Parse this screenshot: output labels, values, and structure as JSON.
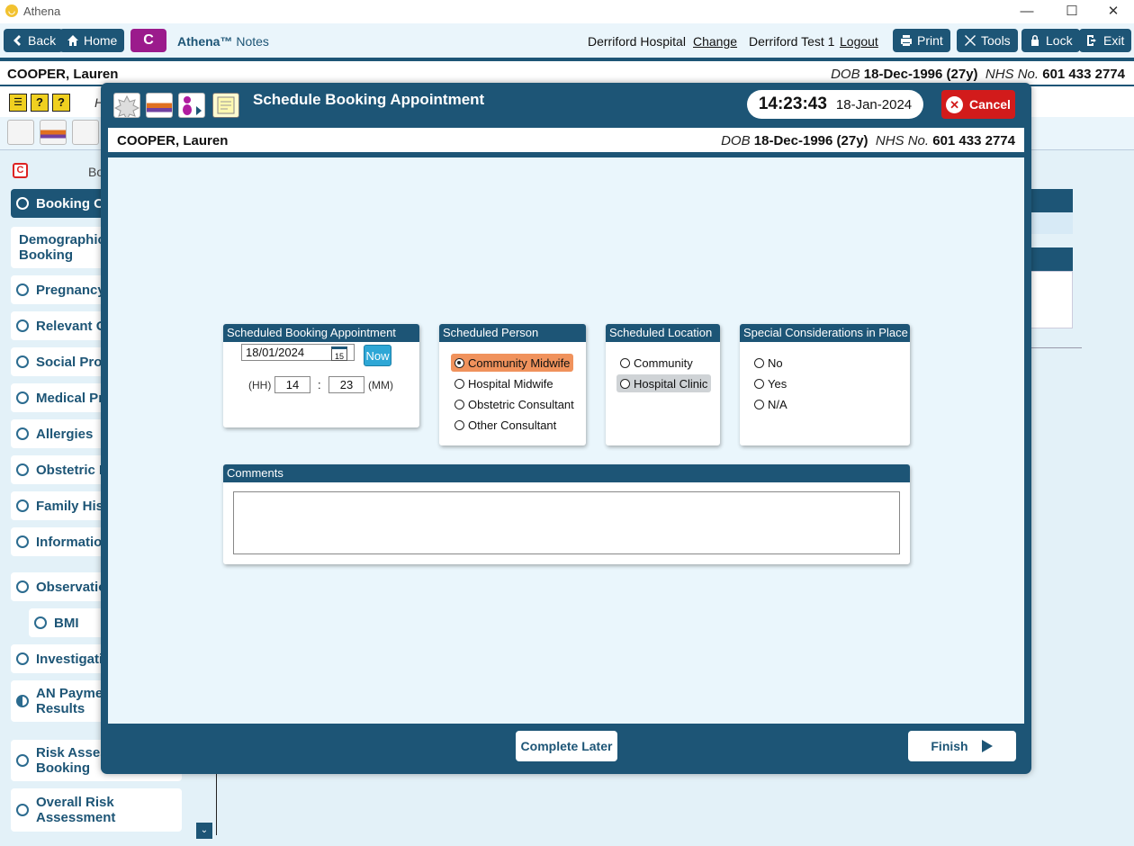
{
  "window": {
    "title": "Athena"
  },
  "topbar": {
    "back": "Back",
    "home": "Home",
    "c_button": "C",
    "app_name": "Athena™",
    "app_section": "Notes",
    "hospital": "Derriford Hospital",
    "change": "Change",
    "user": "Derriford Test 1",
    "logout": "Logout",
    "print": "Print",
    "tools": "Tools",
    "lock": "Lock",
    "exit": "Exit"
  },
  "patient": {
    "name": "COOPER, Lauren",
    "dob_label": "DOB",
    "dob": "18-Dec-1996 (27y)",
    "nhs_label": "NHS No.",
    "nhs": "601 433 2774"
  },
  "row3": {
    "partial": "H"
  },
  "sidebar": {
    "header_partial": "Bo",
    "items": [
      {
        "label": "Booking Ov"
      },
      {
        "label": "Demographics Booking"
      },
      {
        "label": "Pregnancy I"
      },
      {
        "label": "Relevant Ot"
      },
      {
        "label": "Social Profil"
      },
      {
        "label": "Medical Pro"
      },
      {
        "label": "Allergies"
      },
      {
        "label": "Obstetric H"
      },
      {
        "label": "Family Histo"
      },
      {
        "label": "Information"
      },
      {
        "label": "Observation"
      },
      {
        "label": "BMI"
      },
      {
        "label": "Investigatio"
      },
      {
        "label": "AN Paymen Results"
      },
      {
        "label": "Risk Assess Booking"
      },
      {
        "label": "Overall Risk Assessment"
      }
    ]
  },
  "dialog": {
    "title": "Schedule Booking Appointment",
    "time": "14:23:43",
    "date": "18-Jan-2024",
    "cancel": "Cancel",
    "appointment": {
      "header": "Scheduled Booking Appointment",
      "date_value": "18/01/2024",
      "calendar_day": "15",
      "now": "Now",
      "hh_label": "(HH)",
      "hh_value": "14",
      "colon": ":",
      "mm_value": "23",
      "mm_label": "(MM)"
    },
    "person": {
      "header": "Scheduled Person",
      "options": [
        "Community Midwife",
        "Hospital Midwife",
        "Obstetric Consultant",
        "Other Consultant"
      ],
      "selected": "Community Midwife"
    },
    "location": {
      "header": "Scheduled Location",
      "options": [
        "Community",
        "Hospital Clinic"
      ]
    },
    "special": {
      "header": "Special Considerations in Place",
      "options": [
        "No",
        "Yes",
        "N/A"
      ]
    },
    "comments": {
      "header": "Comments",
      "value": ""
    },
    "complete_later": "Complete Later",
    "finish": "Finish"
  },
  "colors": {
    "primary": "#1d5576",
    "cancel": "#d21b1b",
    "selected": "#f0925c",
    "accent_purple": "#9b1b8c",
    "now_button": "#2ea7d6"
  }
}
